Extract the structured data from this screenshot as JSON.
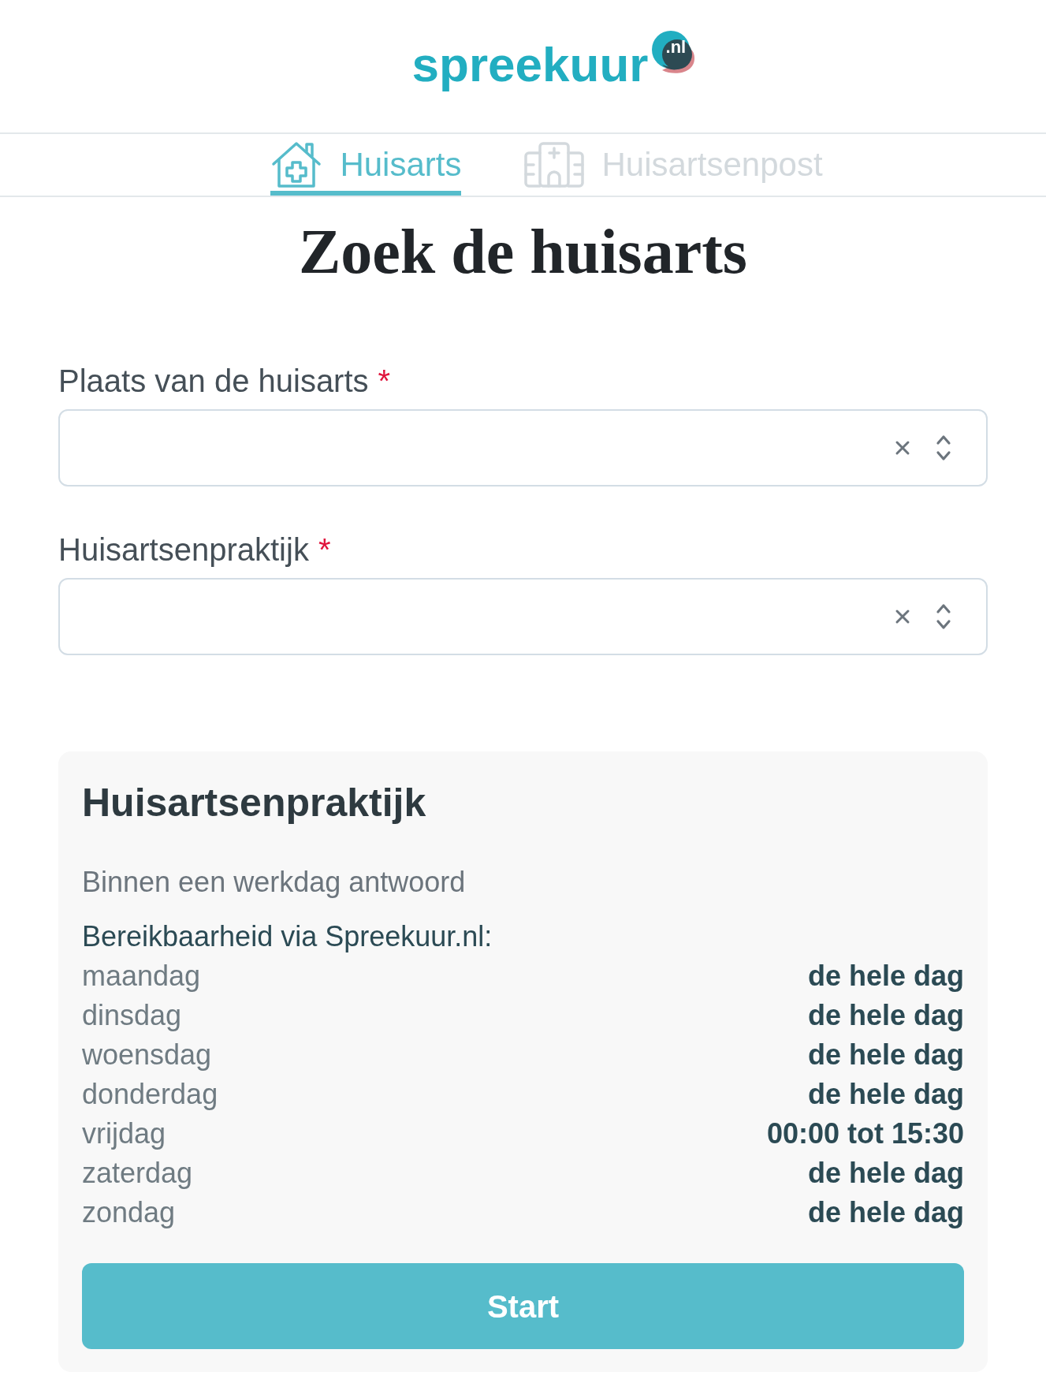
{
  "logo": {
    "wordmark": "spreekuur",
    "badge": ".nl"
  },
  "tabs": [
    {
      "label": "Huisarts",
      "kind": "house",
      "selected": true
    },
    {
      "label": "Huisartsenpost",
      "kind": "hospital",
      "selected": false
    }
  ],
  "heading": "Zoek de huisarts",
  "fields": [
    {
      "label": "Plaats van de huisarts",
      "required_mark": "*"
    },
    {
      "label": "Huisartsenpraktijk",
      "required_mark": "*"
    }
  ],
  "card": {
    "title": "Huisartsenpraktijk",
    "response_time": "Binnen een werkdag antwoord",
    "availability_heading": "Bereikbaarheid via Spreekuur.nl:",
    "schedule": [
      {
        "day": "maandag",
        "hours": "de hele dag"
      },
      {
        "day": "dinsdag",
        "hours": "de hele dag"
      },
      {
        "day": "woensdag",
        "hours": "de hele dag"
      },
      {
        "day": "donderdag",
        "hours": "de hele dag"
      },
      {
        "day": "vrijdag",
        "hours": "00:00 tot 15:30"
      },
      {
        "day": "zaterdag",
        "hours": "de hele dag"
      },
      {
        "day": "zondag",
        "hours": "de hele dag"
      }
    ],
    "button": "Start"
  }
}
